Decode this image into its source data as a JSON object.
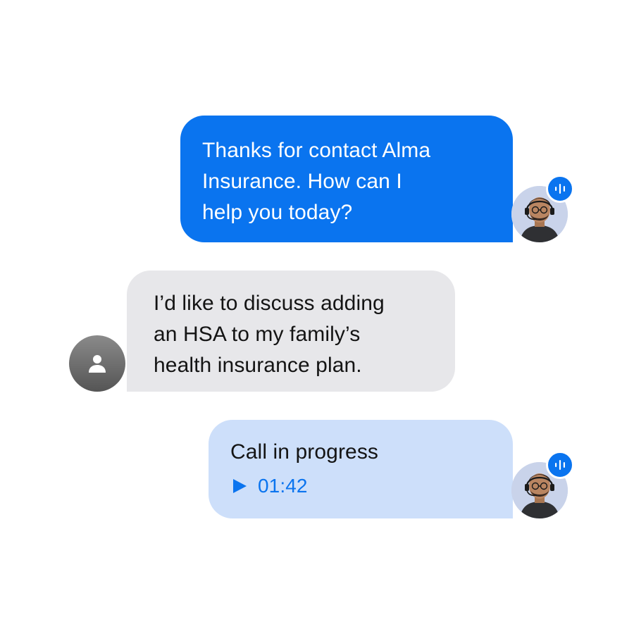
{
  "messages": [
    {
      "role": "agent",
      "text": "Thanks for contact Alma Insurance. How can I help you today?",
      "lines": [
        "Thanks for contact Alma",
        "Insurance. How can I",
        "help you today?"
      ]
    },
    {
      "role": "user",
      "text": "I’d like to discuss adding an HSA to my family’s health insurance plan.",
      "lines": [
        "I’d like to discuss adding",
        "an HSA to my family’s",
        "health insurance plan."
      ]
    },
    {
      "role": "agent",
      "type": "call",
      "title": "Call in progress",
      "duration": "01:42"
    }
  ],
  "icons": {
    "agent_badge": "voice-waveform-icon",
    "user_avatar": "person-icon",
    "call_play": "play-icon"
  },
  "colors": {
    "agent_bubble": "#0a74ef",
    "user_bubble": "#e7e7ea",
    "call_bubble": "#cddffa",
    "accent": "#0a74ef"
  }
}
